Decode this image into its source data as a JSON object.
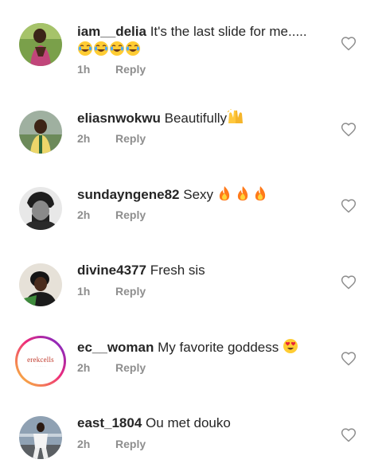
{
  "comments": [
    {
      "username": "iam__delia",
      "text": "It's the last slide for me.....",
      "emoji": [
        "joy-emoji",
        "joy-emoji",
        "joy-emoji",
        "joy-emoji"
      ],
      "time": "1h",
      "reply_label": "Reply"
    },
    {
      "username": "eliasnwokwu",
      "text": "Beautifully",
      "emoji": [
        "raising-hands-emoji"
      ],
      "time": "2h",
      "reply_label": "Reply"
    },
    {
      "username": "sundayngene82",
      "text": "Sexy",
      "emoji": [
        "fire-emoji",
        "fire-emoji",
        "fire-emoji"
      ],
      "time": "2h",
      "reply_label": "Reply"
    },
    {
      "username": "divine4377",
      "text": "Fresh sis",
      "emoji": [],
      "time": "1h",
      "reply_label": "Reply"
    },
    {
      "username": "ec__woman",
      "text": "My favorite goddess",
      "emoji": [
        "heart-eyes-emoji"
      ],
      "time": "2h",
      "reply_label": "Reply",
      "avatar_brand": "erekcells"
    },
    {
      "username": "east_1804",
      "text": "Ou met douko",
      "emoji": [],
      "time": "2h",
      "reply_label": "Reply"
    }
  ],
  "colors": {
    "text": "#262626",
    "meta": "#8e8e8e",
    "background": "#ffffff",
    "story_ring": "#ee2a7b"
  },
  "icons": {
    "like": "heart-outline-icon"
  }
}
